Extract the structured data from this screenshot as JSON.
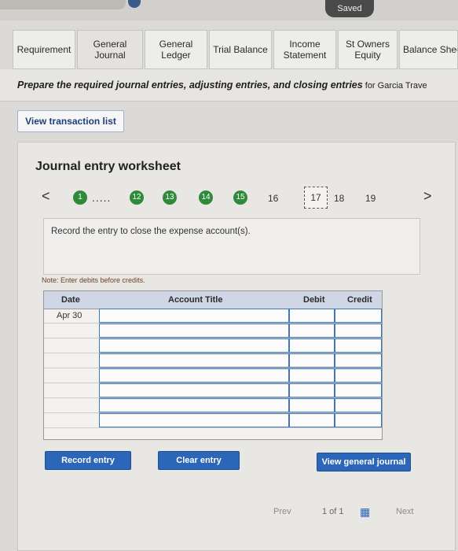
{
  "header": {
    "saved_label": "Saved"
  },
  "tabs": [
    {
      "label": "Requirement"
    },
    {
      "label": "General\nJournal"
    },
    {
      "label": "General\nLedger"
    },
    {
      "label": "Trial Balance"
    },
    {
      "label": "Income\nStatement"
    },
    {
      "label": "St Owners\nEquity"
    },
    {
      "label": "Balance Shee"
    }
  ],
  "instruction": {
    "strong": "Prepare the required journal entries, adjusting entries, and closing entries",
    "rest": " for Garcia Trave"
  },
  "view_transaction_button": "View transaction list",
  "worksheet": {
    "title": "Journal entry worksheet",
    "nav": {
      "prev": "<",
      "next": ">",
      "first": "1",
      "ellipsis": ".....",
      "completed": [
        "12",
        "13",
        "14",
        "15"
      ],
      "pending": [
        "16",
        "17",
        "18",
        "19"
      ]
    },
    "record_instruction": "Record the entry to close the expense account(s).",
    "note": "Note: Enter debits before credits.",
    "table": {
      "headers": {
        "date": "Date",
        "account": "Account Title",
        "debit": "Debit",
        "credit": "Credit"
      },
      "first_date": "Apr 30",
      "row_count": 8
    },
    "buttons": {
      "record": "Record entry",
      "clear": "Clear entry",
      "view_journal": "View general journal"
    }
  },
  "pager": {
    "prev": "Prev",
    "count": "1 of 1",
    "next": "Next"
  },
  "colors": {
    "accent": "#2c66b8",
    "progress_green": "#2f8a3b"
  }
}
